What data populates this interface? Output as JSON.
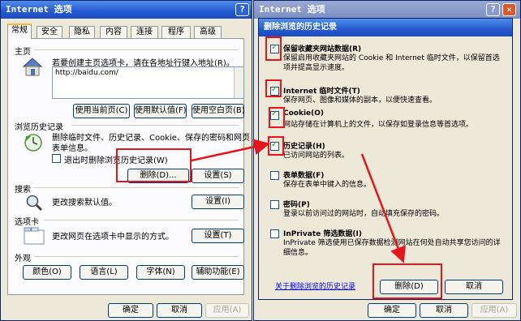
{
  "left_window": {
    "title": "Internet 选项",
    "tabs": [
      "常规",
      "安全",
      "隐私",
      "内容",
      "连接",
      "程序",
      "高级"
    ],
    "home": {
      "heading": "主页",
      "hint": "若要创建主页选项卡，请在各地址行键入地址(R)。",
      "url": "http://baidu.com/",
      "btn_current": "使用当前页(C)",
      "btn_default": "使用默认值(F)",
      "btn_blank": "使用空白页(B)"
    },
    "history": {
      "heading": "浏览历史记录",
      "desc_line1": "删除临时文件、历史记录、Cookie、保存的密码和网页",
      "desc_line2": "表单信息。",
      "checkbox_label": "退出时删除浏览历史记录(W)",
      "btn_delete": "删除(D)...",
      "btn_settings": "设置(S)"
    },
    "search": {
      "heading": "搜索",
      "desc": "更改搜索默认值。",
      "btn_settings": "设置(I)"
    },
    "tabs_section": {
      "heading": "选项卡",
      "desc": "更改网页在选项卡中显示的方式。",
      "btn_settings": "设置(T)"
    },
    "appearance": {
      "heading": "外观",
      "btn_colors": "颜色(O)",
      "btn_languages": "语言(L)",
      "btn_fonts": "字体(N)",
      "btn_accessibility": "辅助功能(E)"
    },
    "footer": {
      "ok": "确定",
      "cancel": "取消",
      "apply": "应用(A)"
    }
  },
  "right_window": {
    "title": "Internet 选项",
    "footer": {
      "ok": "确定",
      "cancel": "取消",
      "apply": "应用(A)"
    }
  },
  "dialog": {
    "title": "删除浏览的历史记录",
    "items": [
      {
        "label": "保留收藏夹网站数据(R)",
        "checked": true,
        "desc": "保留启用收藏夹网站的 Cookie 和 Internet 临时文件，以保留首选项并提高显示速度。"
      },
      {
        "label": "Internet 临时文件(T)",
        "checked": true,
        "desc": "保存网页、图像和媒体的副本，以便快速查看。"
      },
      {
        "label": "Cookie(O)",
        "checked": true,
        "desc": "网站存储在计算机上的文件，以保存如登录信息等首选项。"
      },
      {
        "label": "历史记录(H)",
        "checked": true,
        "desc": "已访问网站的列表。"
      },
      {
        "label": "表单数据(F)",
        "checked": false,
        "desc": "保存在表单中键入的信息。"
      },
      {
        "label": "密码(P)",
        "checked": false,
        "desc": "登录以前访问过的网站时，自动填充保存的密码。"
      },
      {
        "label": "InPrivate 筛选数据(I)",
        "checked": false,
        "desc": "InPrivate 筛选使用已保存数据检测网站在何处自动共享您访问的详细信息。"
      }
    ],
    "link": "关于删除浏览的历史记录",
    "btn_delete": "删除(D)",
    "btn_cancel": "取消"
  },
  "colors": {
    "annotation": "#e8141c",
    "titlebar": "#2459d1"
  }
}
